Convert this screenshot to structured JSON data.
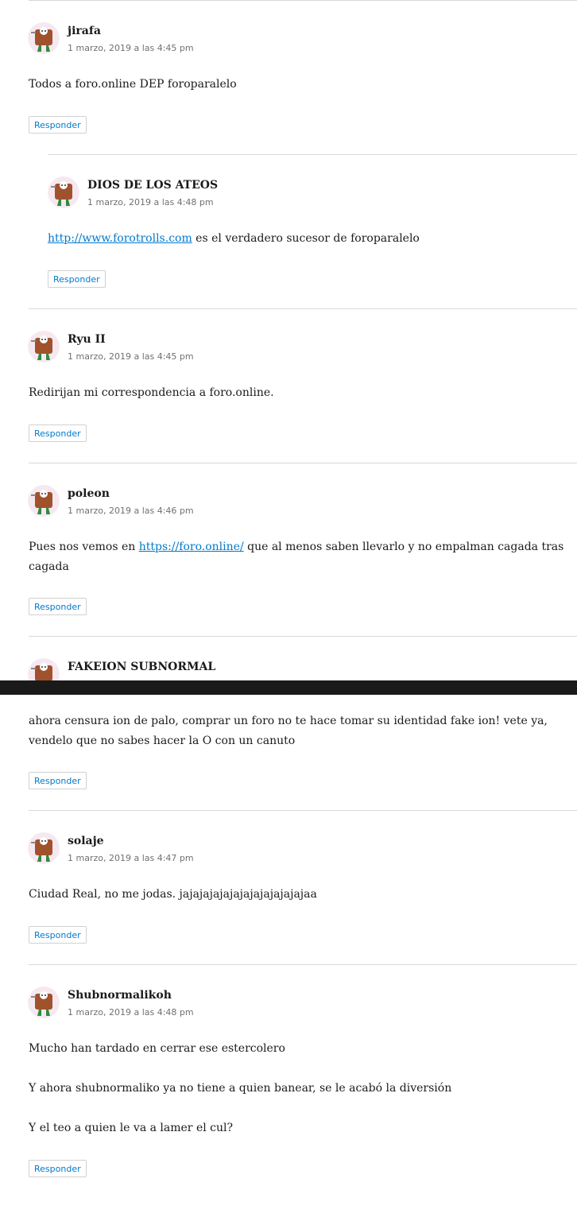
{
  "reply_label": "Responder",
  "comments": [
    {
      "author": "jirafa",
      "date": "1 marzo, 2019 a las 4:45 pm",
      "lines": [
        "Todos a foro.online DEP foroparalelo"
      ]
    },
    {
      "author": "DIOS DE LOS ATEOS",
      "date": "1 marzo, 2019 a las 4:48 pm",
      "link": "http://www.forotrolls.com",
      "after_link": " es el verdadero sucesor de foroparalelo"
    },
    {
      "author": "Ryu II",
      "date": "1 marzo, 2019 a las 4:45 pm",
      "lines": [
        "Redirijan mi correspondencia a foro.online."
      ]
    },
    {
      "author": "poleon",
      "date": "1 marzo, 2019 a las 4:46 pm",
      "before_link": "Pues nos vemos en ",
      "link": "https://foro.online/",
      "after_link": " que al menos saben llevarlo y no empalman cagada tras",
      "line2": "cagada"
    },
    {
      "author": "FAKEION SUBNORMAL",
      "lines": [
        "ahora censura ion de palo, comprar un foro no te hace tomar su identidad fake ion! vete ya,",
        "vendelo que no sabes hacer la O con un canuto"
      ]
    },
    {
      "author": "solaje",
      "date": "1 marzo, 2019 a las 4:47 pm",
      "lines": [
        "Ciudad Real, no me jodas. jajajajajajajajajajajajajaa"
      ]
    },
    {
      "author": "Shubnormalikoh",
      "date": "1 marzo, 2019 a las 4:48 pm",
      "lines": [
        "Mucho han tardado en cerrar ese estercolero",
        "Y ahora shubnormaliko ya no tiene a quien banear, se le acabó la diversión",
        "Y el teo a quien le va a lamer el cul?"
      ]
    }
  ],
  "colors": {
    "link": "#007acc",
    "divider": "#d9d9d9",
    "date": "#707070"
  },
  "avatar_icon": "monster-avatar-icon"
}
